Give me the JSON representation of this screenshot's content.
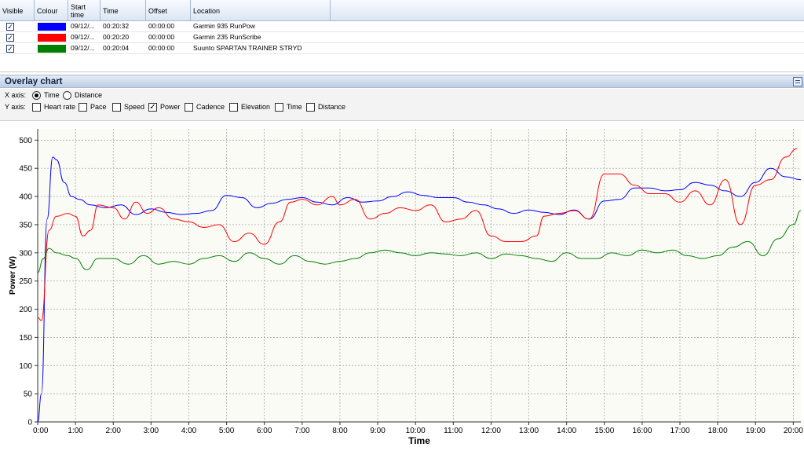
{
  "grid": {
    "headers": {
      "visible": "Visible",
      "colour": "Colour",
      "start_time": "Start time",
      "time": "Time",
      "offset": "Offset",
      "location": "Location"
    },
    "rows": [
      {
        "visible": true,
        "colour": "#0000ff",
        "start": "09/12/...",
        "time": "00:20:32",
        "offset": "00:00:00",
        "location": "Garmin 935 RunPow"
      },
      {
        "visible": true,
        "colour": "#ff0000",
        "start": "09/12/...",
        "time": "00:20:20",
        "offset": "00:00:00",
        "location": "Garmin 235 RunScribe"
      },
      {
        "visible": true,
        "colour": "#008000",
        "start": "09/12/...",
        "time": "00:20:04",
        "offset": "00:00:00",
        "location": "Suunto SPARTAN TRAINER STRYD"
      }
    ]
  },
  "panel": {
    "title": "Overlay chart",
    "x_axis_label": "X axis:",
    "x_options": [
      {
        "label": "Time",
        "selected": true
      },
      {
        "label": "Distance",
        "selected": false
      }
    ],
    "y_axis_label": "Y axis:",
    "y_options": [
      {
        "label": "Heart rate",
        "checked": false
      },
      {
        "label": "Pace",
        "checked": false
      },
      {
        "label": "Speed",
        "checked": false
      },
      {
        "label": "Power",
        "checked": true
      },
      {
        "label": "Cadence",
        "checked": false
      },
      {
        "label": "Elevation",
        "checked": false
      },
      {
        "label": "Time",
        "checked": false
      },
      {
        "label": "Distance",
        "checked": false
      }
    ]
  },
  "chart_data": {
    "type": "line",
    "xlabel": "Time",
    "ylabel": "Power (W)",
    "ylim": [
      0,
      520
    ],
    "xlim_minutes": [
      0,
      20.2
    ],
    "yticks": [
      0,
      50,
      100,
      150,
      200,
      250,
      300,
      350,
      400,
      450,
      500
    ],
    "xticks": [
      "0:00",
      "1:00",
      "2:00",
      "3:00",
      "4:00",
      "5:00",
      "6:00",
      "7:00",
      "8:00",
      "9:00",
      "10:00",
      "11:00",
      "12:00",
      "13:00",
      "14:00",
      "15:00",
      "16:00",
      "17:00",
      "18:00",
      "19:00",
      "20:00"
    ],
    "grid": true,
    "series": [
      {
        "color": "#0000ff",
        "x": [
          0,
          0.1,
          0.25,
          0.4,
          0.5,
          0.7,
          0.9,
          1.1,
          1.4,
          1.8,
          2.2,
          2.6,
          3,
          3.4,
          3.8,
          4.2,
          4.6,
          5,
          5.4,
          5.8,
          6.2,
          6.6,
          7,
          7.4,
          7.8,
          8.2,
          8.6,
          9,
          9.4,
          9.8,
          10.2,
          10.6,
          11,
          11.4,
          11.8,
          12.2,
          12.6,
          13,
          13.4,
          13.8,
          14.2,
          14.6,
          15,
          15.4,
          15.8,
          16.2,
          16.6,
          17,
          17.4,
          17.8,
          18.2,
          18.6,
          19,
          19.4,
          19.8,
          20.2
        ],
        "y": [
          0,
          50,
          360,
          470,
          465,
          425,
          400,
          395,
          385,
          380,
          385,
          368,
          378,
          372,
          368,
          370,
          375,
          402,
          398,
          380,
          388,
          395,
          398,
          390,
          385,
          398,
          390,
          392,
          400,
          408,
          402,
          398,
          398,
          390,
          385,
          378,
          370,
          376,
          372,
          368,
          376,
          360,
          392,
          395,
          415,
          415,
          410,
          412,
          425,
          420,
          410,
          400,
          425,
          450,
          435,
          430
        ]
      },
      {
        "color": "#ff0000",
        "x": [
          0,
          0.1,
          0.3,
          0.5,
          0.8,
          1.0,
          1.2,
          1.4,
          1.6,
          2,
          2.3,
          2.6,
          2.9,
          3.2,
          3.6,
          4,
          4.4,
          4.8,
          5.2,
          5.6,
          6,
          6.4,
          6.7,
          7,
          7.4,
          7.8,
          8,
          8.4,
          8.8,
          9.2,
          9.6,
          10,
          10.4,
          10.8,
          11.2,
          11.6,
          12,
          12.4,
          12.8,
          13.2,
          13.4,
          13.8,
          14.2,
          14.6,
          15,
          15.4,
          15.8,
          16.2,
          16.6,
          17,
          17.4,
          17.8,
          18.2,
          18.6,
          19,
          19.4,
          19.8,
          20.1
        ],
        "y": [
          185,
          180,
          340,
          365,
          370,
          365,
          330,
          340,
          385,
          380,
          360,
          390,
          370,
          380,
          360,
          355,
          345,
          350,
          320,
          335,
          315,
          355,
          390,
          395,
          385,
          400,
          385,
          395,
          360,
          370,
          380,
          375,
          385,
          355,
          360,
          375,
          330,
          320,
          320,
          330,
          365,
          370,
          375,
          360,
          440,
          440,
          420,
          405,
          405,
          390,
          410,
          385,
          430,
          350,
          420,
          430,
          470,
          485
        ]
      },
      {
        "color": "#008000",
        "x": [
          0,
          0.15,
          0.3,
          0.5,
          0.8,
          1,
          1.3,
          1.6,
          2,
          2.4,
          2.8,
          3.2,
          3.6,
          4,
          4.4,
          4.8,
          5.2,
          5.6,
          6,
          6.4,
          6.8,
          7.2,
          7.6,
          8,
          8.4,
          8.8,
          9.2,
          9.6,
          10,
          10.4,
          10.8,
          11.2,
          11.6,
          12,
          12.4,
          12.8,
          13.2,
          13.6,
          14,
          14.4,
          14.8,
          15.2,
          15.6,
          16,
          16.4,
          16.8,
          17.2,
          17.6,
          18,
          18.4,
          18.8,
          19.2,
          19.6,
          20,
          20.2
        ],
        "y": [
          265,
          290,
          308,
          300,
          295,
          290,
          270,
          290,
          290,
          280,
          295,
          280,
          285,
          280,
          290,
          295,
          285,
          300,
          290,
          280,
          295,
          285,
          280,
          285,
          290,
          300,
          305,
          300,
          295,
          300,
          298,
          295,
          300,
          290,
          298,
          295,
          290,
          285,
          300,
          290,
          290,
          300,
          295,
          305,
          300,
          305,
          295,
          290,
          295,
          310,
          320,
          295,
          325,
          350,
          375
        ]
      }
    ]
  }
}
